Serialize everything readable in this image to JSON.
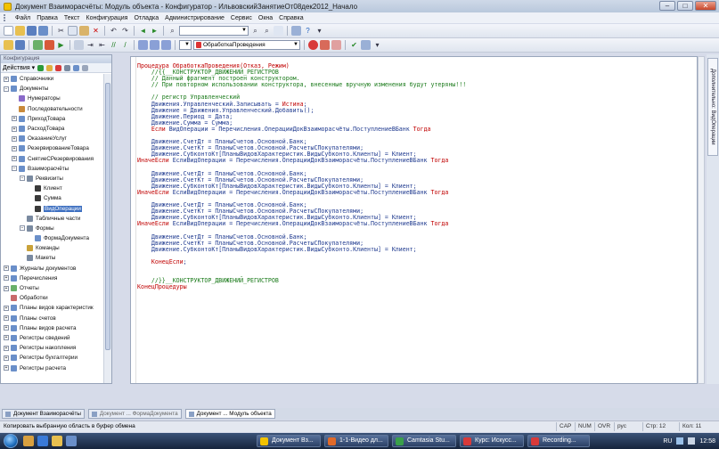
{
  "window": {
    "title": "Документ Взаиморасчёты: Модуль объекта - Конфигуратор - ИльвовскийЗанятиеОт08дек2012_Начало",
    "minimize": "–",
    "maximize": "□",
    "close": "✕"
  },
  "menu": [
    "Файл",
    "Правка",
    "Текст",
    "Конфигурация",
    "Отладка",
    "Администрирование",
    "Сервис",
    "Окна",
    "Справка"
  ],
  "toolbar2": {
    "procedure_combo": "ОбработкаПроведения"
  },
  "left_panel": {
    "header": "Конфигурация",
    "actions_label": "Действия ▾",
    "tree": [
      {
        "label": "Справочники",
        "indent": 0,
        "exp": "+",
        "icon": "#6a8fc9"
      },
      {
        "label": "Документы",
        "indent": 0,
        "exp": "−",
        "icon": "#6a8fc9"
      },
      {
        "label": "Нумераторы",
        "indent": 1,
        "exp": "",
        "icon": "#8a6ac9"
      },
      {
        "label": "Последовательности",
        "indent": 1,
        "exp": "",
        "icon": "#c98a3a"
      },
      {
        "label": "ПриходТовара",
        "indent": 1,
        "exp": "+",
        "icon": "#6a8fc9"
      },
      {
        "label": "РасходТовара",
        "indent": 1,
        "exp": "+",
        "icon": "#6a8fc9"
      },
      {
        "label": "ОказаниеУслуг",
        "indent": 1,
        "exp": "+",
        "icon": "#6a8fc9"
      },
      {
        "label": "РезервированиеТовара",
        "indent": 1,
        "exp": "+",
        "icon": "#6a8fc9"
      },
      {
        "label": "СнятиеСРезервирования",
        "indent": 1,
        "exp": "+",
        "icon": "#6a8fc9"
      },
      {
        "label": "Взаиморасчёты",
        "indent": 1,
        "exp": "−",
        "icon": "#6a8fc9"
      },
      {
        "label": "Реквизиты",
        "indent": 2,
        "exp": "−",
        "icon": "#7a8aa0"
      },
      {
        "label": "Клиент",
        "indent": 3,
        "exp": "",
        "icon": "#3a3a3a"
      },
      {
        "label": "Сумма",
        "indent": 3,
        "exp": "",
        "icon": "#3a3a3a"
      },
      {
        "label": "ВидОперации",
        "indent": 3,
        "exp": "",
        "icon": "#3a3a3a",
        "selected": true
      },
      {
        "label": "Табличные части",
        "indent": 2,
        "exp": "",
        "icon": "#7a8aa0"
      },
      {
        "label": "Формы",
        "indent": 2,
        "exp": "−",
        "icon": "#7a8aa0"
      },
      {
        "label": "ФормаДокумента",
        "indent": 3,
        "exp": "",
        "icon": "#6a8fc9"
      },
      {
        "label": "Команды",
        "indent": 2,
        "exp": "",
        "icon": "#c9a23a"
      },
      {
        "label": "Макеты",
        "indent": 2,
        "exp": "",
        "icon": "#7a8aa0"
      },
      {
        "label": "Журналы документов",
        "indent": 0,
        "exp": "+",
        "icon": "#6a8fc9"
      },
      {
        "label": "Перечисления",
        "indent": 0,
        "exp": "+",
        "icon": "#6a8fc9"
      },
      {
        "label": "Отчеты",
        "indent": 0,
        "exp": "+",
        "icon": "#6ab06a"
      },
      {
        "label": "Обработки",
        "indent": 0,
        "exp": "",
        "icon": "#c96a6a"
      },
      {
        "label": "Планы видов характеристик",
        "indent": 0,
        "exp": "+",
        "icon": "#6a8fc9"
      },
      {
        "label": "Планы счетов",
        "indent": 0,
        "exp": "+",
        "icon": "#6a8fc9"
      },
      {
        "label": "Планы видов расчета",
        "indent": 0,
        "exp": "+",
        "icon": "#6a8fc9"
      },
      {
        "label": "Регистры сведений",
        "indent": 0,
        "exp": "+",
        "icon": "#6a8fc9"
      },
      {
        "label": "Регистры накопления",
        "indent": 0,
        "exp": "+",
        "icon": "#6a8fc9"
      },
      {
        "label": "Регистры бухгалтерии",
        "indent": 0,
        "exp": "+",
        "icon": "#6a8fc9"
      },
      {
        "label": "Регистры расчета",
        "indent": 0,
        "exp": "+",
        "icon": "#6a8fc9"
      }
    ]
  },
  "code": [
    [
      [
        "Процедура ОбработкаПроведения(Отказ, Режим)",
        "kw"
      ]
    ],
    [
      [
        "    //{{__КОНСТРУКТОР_ДВИЖЕНИЙ_РЕГИСТРОВ",
        "cm"
      ]
    ],
    [
      [
        "    // Данный фрагмент построен конструктором.",
        "cm"
      ]
    ],
    [
      [
        "    // При повторном использовании конструктора, внесенные вручную изменения будут утеряны!!!",
        "cm"
      ]
    ],
    [
      [
        "",
        "pl"
      ]
    ],
    [
      [
        "    // регистр Управленческий",
        "cm"
      ]
    ],
    [
      [
        "    Движения.Управленческий.Записывать = ",
        "id"
      ],
      [
        "Истина",
        "kw"
      ],
      [
        ";",
        "id"
      ]
    ],
    [
      [
        "    Движение = Движения.Управленческий.Добавить();",
        "id"
      ]
    ],
    [
      [
        "    Движение.Период = Дата;",
        "id"
      ]
    ],
    [
      [
        "    Движение.Сумма = Сумма;",
        "id"
      ]
    ],
    [
      [
        "    ",
        "pl"
      ],
      [
        "Если",
        "kw"
      ],
      [
        " ВидОперации = Перечисления.ОперацииДокВзаиморасчёты.ПоступлениеВБанк ",
        "id"
      ],
      [
        "Тогда",
        "kw"
      ]
    ],
    [
      [
        "",
        "pl"
      ]
    ],
    [
      [
        "    Движение.СчетДт = ПланыСчетов.Основной.Банк;",
        "id"
      ]
    ],
    [
      [
        "    Движение.СчетКт = ПланыСчетов.Основной.РасчетыСПокупателями;",
        "id"
      ]
    ],
    [
      [
        "    Движение.СубконтоКт[ПланыВидовХарактеристик.ВидыСубконто.Клиенты] = Клиент;",
        "id"
      ]
    ],
    [
      [
        "ИначеЕсли",
        "kw"
      ],
      [
        " ЕслиВидОперации = Перечисления.ОперацииДокВзаиморасчёты.ПоступлениеВБанк ",
        "id"
      ],
      [
        "Тогда",
        "kw"
      ]
    ],
    [
      [
        "",
        "pl"
      ]
    ],
    [
      [
        "    Движение.СчетДт = ПланыСчетов.Основной.Банк;",
        "id"
      ]
    ],
    [
      [
        "    Движение.СчетКт = ПланыСчетов.Основной.РасчетыСПокупателями;",
        "id"
      ]
    ],
    [
      [
        "    Движение.СубконтоКт[ПланыВидовХарактеристик.ВидыСубконто.Клиенты] = Клиент;",
        "id"
      ]
    ],
    [
      [
        "ИначеЕсли",
        "kw"
      ],
      [
        " ЕслиВидОперации = Перечисления.ОперацииДокВзаиморасчёты.ПоступлениеВБанк ",
        "id"
      ],
      [
        "Тогда",
        "kw"
      ]
    ],
    [
      [
        "",
        "pl"
      ]
    ],
    [
      [
        "    Движение.СчетДт = ПланыСчетов.Основной.Банк;",
        "id"
      ]
    ],
    [
      [
        "    Движение.СчетКт = ПланыСчетов.Основной.РасчетыСПокупателями;",
        "id"
      ]
    ],
    [
      [
        "    Движение.СубконтоКт[ПланыВидовХарактеристик.ВидыСубконто.Клиенты] = Клиент;",
        "id"
      ]
    ],
    [
      [
        "ИначеЕсли",
        "kw"
      ],
      [
        " ЕслиВидОперации = Перечисления.ОперацииДокВзаиморасчёты.ПоступлениеВБанк ",
        "id"
      ],
      [
        "Тогда",
        "kw"
      ]
    ],
    [
      [
        "",
        "pl"
      ]
    ],
    [
      [
        "    Движение.СчетДт = ПланыСчетов.Основной.Банк;",
        "id"
      ]
    ],
    [
      [
        "    Движение.СчетКт = ПланыСчетов.Основной.РасчетыСПокупателями;",
        "id"
      ]
    ],
    [
      [
        "    Движение.СубконтоКт[ПланыВидовХарактеристик.ВидыСубконто.Клиенты] = Клиент;",
        "id"
      ]
    ],
    [
      [
        "",
        "pl"
      ]
    ],
    [
      [
        "    ",
        "pl"
      ],
      [
        "КонецЕсли",
        "kw"
      ],
      [
        ";",
        "id"
      ]
    ],
    [
      [
        "",
        "pl"
      ]
    ],
    [
      [
        "",
        "pl"
      ]
    ],
    [
      [
        "    //}}__КОНСТРУКТОР_ДВИЖЕНИЙ_РЕГИСТРОВ",
        "cm"
      ]
    ],
    [
      [
        "КонецПроцедуры",
        "kw"
      ]
    ]
  ],
  "code_colors": {
    "kw": "#c00000",
    "cm": "#1a7a1a",
    "id": "#1f3a8f",
    "pl": "#000000"
  },
  "right_dock": {
    "tab_label": "Дополнительно: ВидОперации"
  },
  "window_tabs": [
    {
      "label": "Документ Взаиморасчёты",
      "state": "normal"
    },
    {
      "label": "Документ ... ФормаДокумента",
      "state": "dim"
    },
    {
      "label": "Документ ... Модуль объекта",
      "state": "active"
    }
  ],
  "status": {
    "message": "Копировать выбранную область в буфер обмена",
    "cap": "CAP",
    "num": "NUM",
    "ovr": "OVR",
    "lang": "рус",
    "line": "Стр: 12",
    "col": "Кол: 11"
  },
  "taskbar": {
    "tasks": [
      {
        "label": "Документ Вз...",
        "color": "#f2c200"
      },
      {
        "label": "1-1-Видео дл...",
        "color": "#e06a2a"
      },
      {
        "label": "Camtasia Stu...",
        "color": "#3aa04a"
      },
      {
        "label": "Курс: Искусс...",
        "color": "#d83a3a"
      },
      {
        "label": "Recording...",
        "color": "#d83a3a"
      }
    ],
    "lang": "RU",
    "time": "12:58"
  }
}
